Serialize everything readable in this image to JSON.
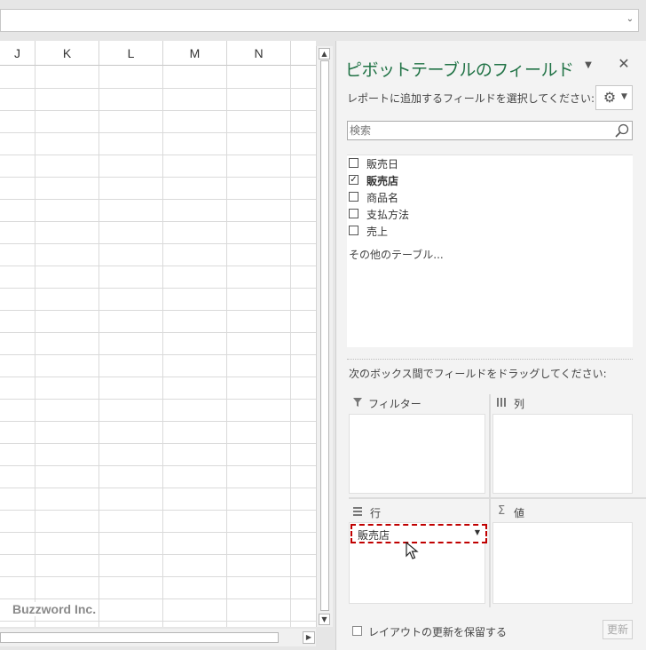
{
  "spreadsheet": {
    "columns": [
      "J",
      "K",
      "L",
      "M",
      "N"
    ],
    "watermark": "Buzzword Inc."
  },
  "pivot_pane": {
    "title": "ピボットテーブルのフィールド",
    "subtitle": "レポートに追加するフィールドを選択してください:",
    "search_placeholder": "検索",
    "fields": [
      {
        "label": "販売日",
        "checked": false
      },
      {
        "label": "販売店",
        "checked": true
      },
      {
        "label": "商品名",
        "checked": false
      },
      {
        "label": "支払方法",
        "checked": false
      },
      {
        "label": "売上",
        "checked": false
      }
    ],
    "more_tables": "その他のテーブル...",
    "drag_instruction": "次のボックス間でフィールドをドラッグしてください:",
    "areas": {
      "filters_label": "フィルター",
      "columns_label": "列",
      "rows_label": "行",
      "values_label": "値"
    },
    "row_field": "販売店",
    "defer_update_label": "レイアウトの更新を保留する",
    "update_button": "更新"
  },
  "icons": [
    "gear-icon",
    "search-icon",
    "close-icon",
    "dropdown-icon",
    "filter-icon",
    "columns-icon",
    "rows-icon",
    "sigma-icon",
    "mouse-cursor-icon"
  ],
  "colors": {
    "title_green": "#217346",
    "drop_highlight_red": "#c00000"
  }
}
